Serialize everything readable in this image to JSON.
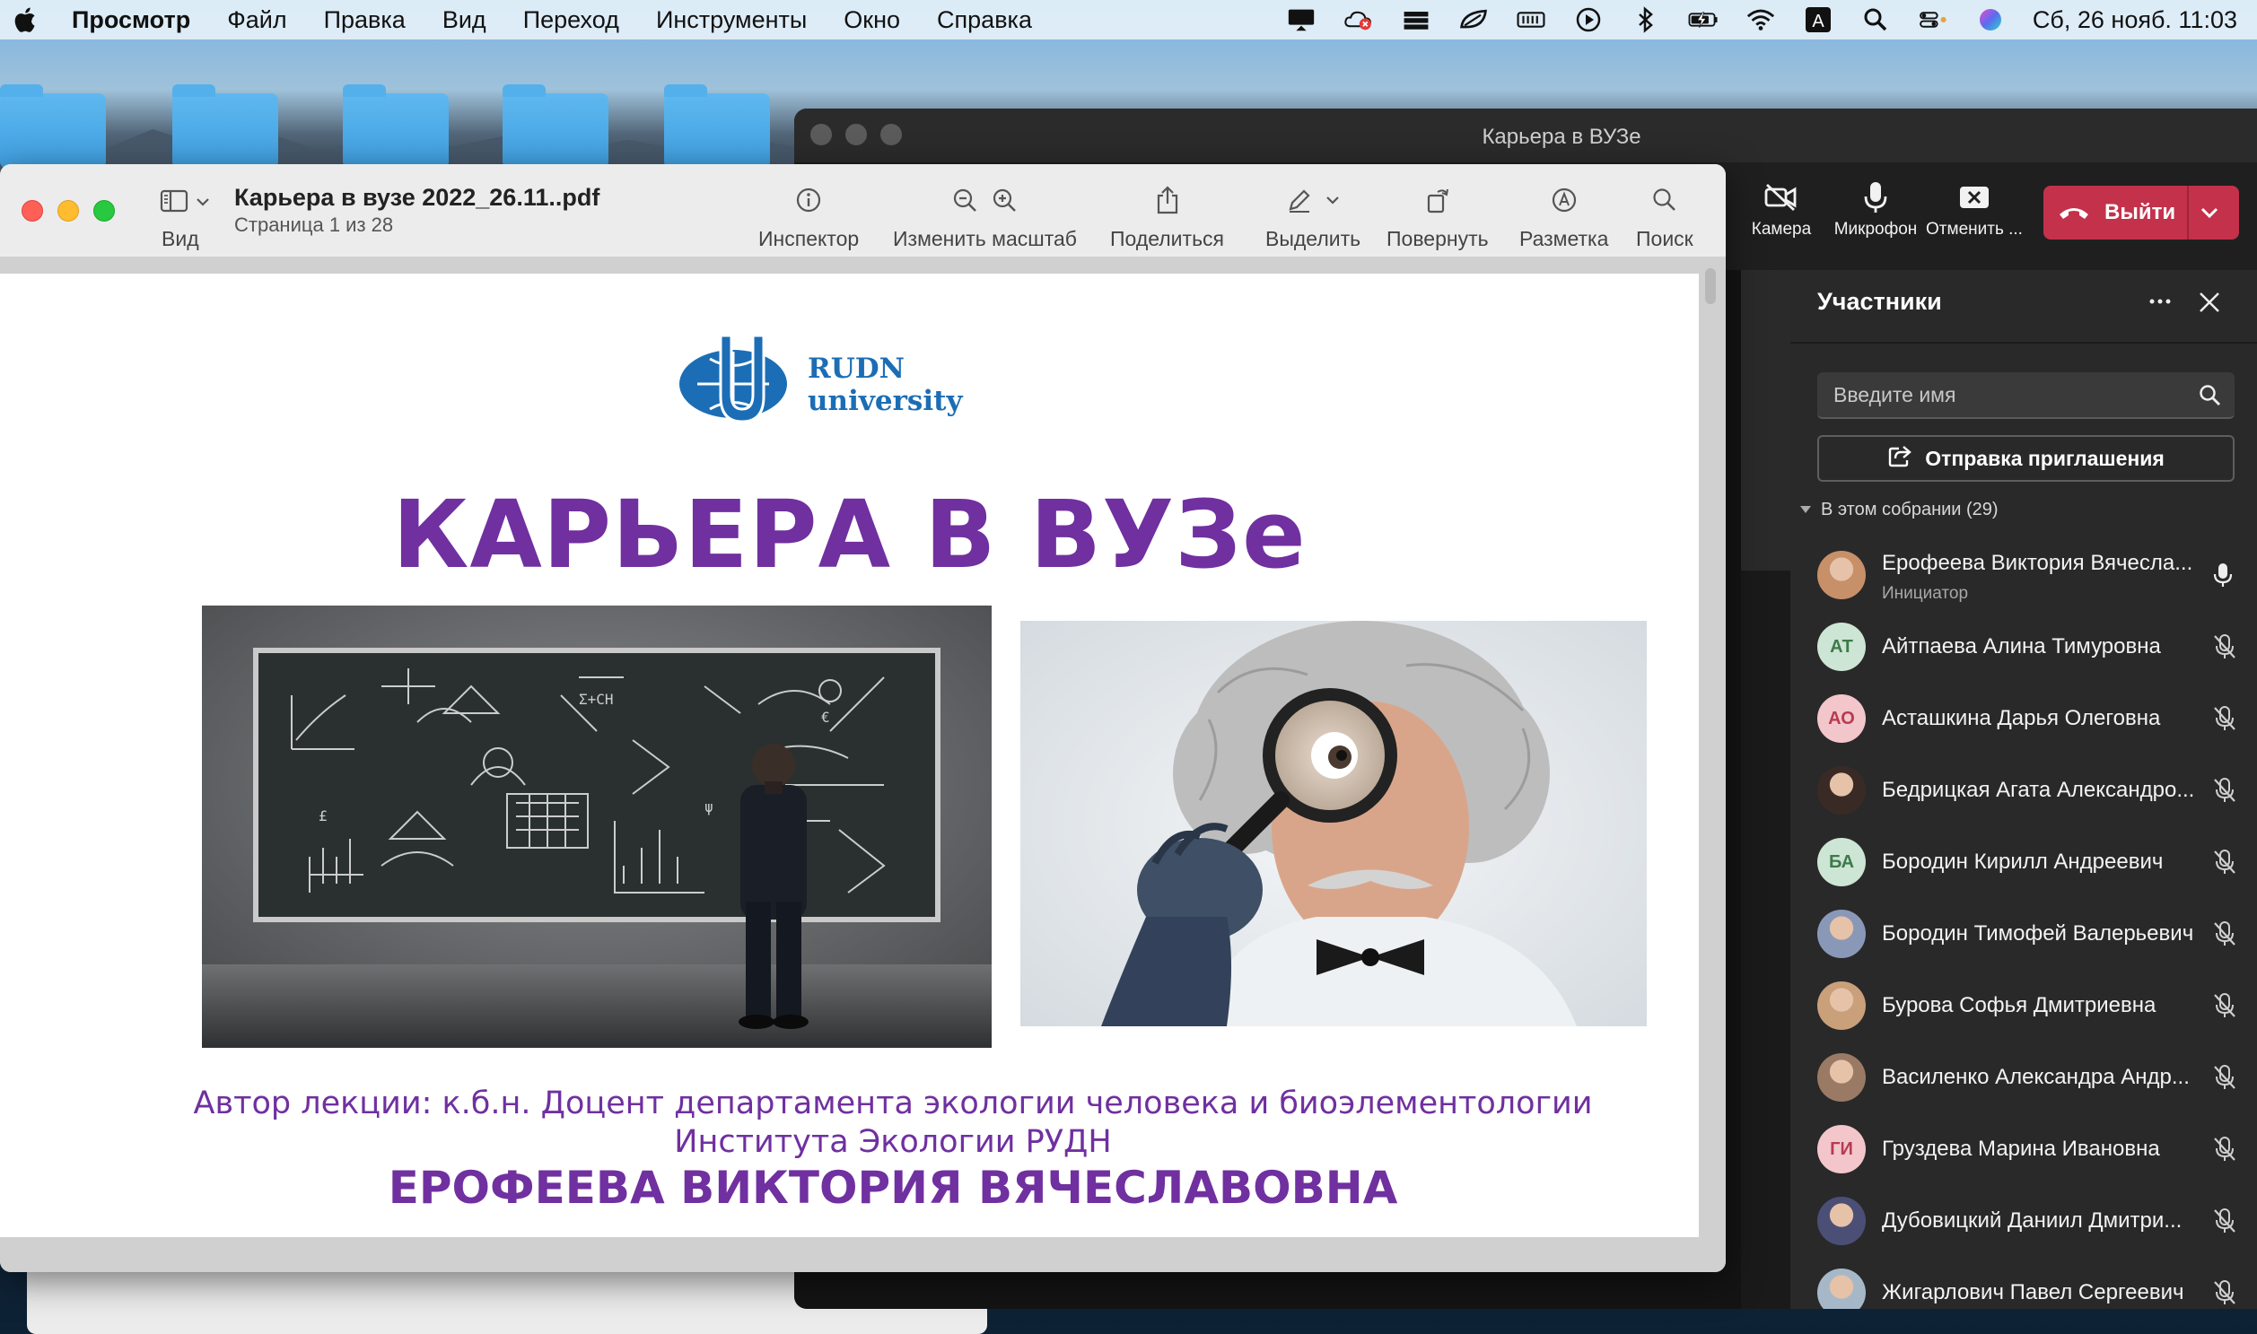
{
  "menubar": {
    "app_name": "Просмотр",
    "items": [
      "Файл",
      "Правка",
      "Вид",
      "Переход",
      "Инструменты",
      "Окно",
      "Справка"
    ],
    "input_source": "A",
    "clock": "Сб, 26 нояб.  11:03"
  },
  "teams": {
    "window_title": "Карьера в ВУЗе",
    "toolbar": {
      "camera": "Камера",
      "mic": "Микрофон",
      "cancel": "Отменить ...",
      "leave": "Выйти"
    },
    "participants": {
      "title": "Участники",
      "search_placeholder": "Введите имя",
      "invite_button": "Отправка приглашения",
      "section_label": "В этом собрании (29)",
      "list": [
        {
          "name": "Ерофеева Виктория Вячесла...",
          "role": "Инициатор",
          "initials": "",
          "avatar_color": "#c79068",
          "mic": "on"
        },
        {
          "name": "Айтпаева Алина Тимуровна",
          "role": "",
          "initials": "АТ",
          "avatar_color": "#cde5d4",
          "initials_color": "#3c7a4a",
          "mic": "off"
        },
        {
          "name": "Асташкина Дарья Олеговна",
          "role": "",
          "initials": "АО",
          "avatar_color": "#f3c6cc",
          "initials_color": "#b73b50",
          "mic": "off"
        },
        {
          "name": "Бедрицкая Агата Александро...",
          "role": "",
          "initials": "",
          "avatar_color": "#3a2a26",
          "mic": "off"
        },
        {
          "name": "Бородин Кирилл Андреевич",
          "role": "",
          "initials": "БА",
          "avatar_color": "#cde5d4",
          "initials_color": "#3c7a4a",
          "mic": "off"
        },
        {
          "name": "Бородин Тимофей Валерьевич",
          "role": "",
          "initials": "",
          "avatar_color": "#8a98b8",
          "mic": "off"
        },
        {
          "name": "Бурова Софья Дмитриевна",
          "role": "",
          "initials": "",
          "avatar_color": "#c9a07a",
          "mic": "off"
        },
        {
          "name": "Василенко Александра Андр...",
          "role": "",
          "initials": "",
          "avatar_color": "#9a7a64",
          "mic": "off"
        },
        {
          "name": "Груздева Марина Ивановна",
          "role": "",
          "initials": "ГИ",
          "avatar_color": "#f3c6cc",
          "initials_color": "#b73b50",
          "mic": "off"
        },
        {
          "name": "Дубовицкий Даниил Дмитри...",
          "role": "",
          "initials": "",
          "avatar_color": "#4b4f76",
          "mic": "off"
        },
        {
          "name": "Жигарлович Павел Сергеевич",
          "role": "",
          "initials": "",
          "avatar_color": "#a6b8c8",
          "mic": "off"
        }
      ]
    }
  },
  "preview": {
    "doc_title": "Карьера в вузе 2022_26.11..pdf",
    "page_info": "Страница 1 из 28",
    "view_label": "Вид",
    "tools": {
      "inspector": "Инспектор",
      "zoom": "Изменить масштаб",
      "share": "Поделиться",
      "highlight": "Выделить",
      "rotate": "Повернуть",
      "markup": "Разметка",
      "search": "Поиск"
    },
    "slide": {
      "logo_line1": "RUDN",
      "logo_line2": "university",
      "title": "КАРЬЕРА В ВУЗе",
      "author_line1": "Автор лекции: к.б.н. Доцент департамента экологии человека и биоэлементологии",
      "author_line2": "Института Экологии РУДН",
      "author_name": "ЕРОФЕЕВА ВИКТОРИЯ ВЯЧЕСЛАВОВНА"
    }
  },
  "colors": {
    "slide_purple": "#7030a0",
    "teams_leave_red": "#c4314b",
    "rudn_blue": "#1b6eb5"
  }
}
